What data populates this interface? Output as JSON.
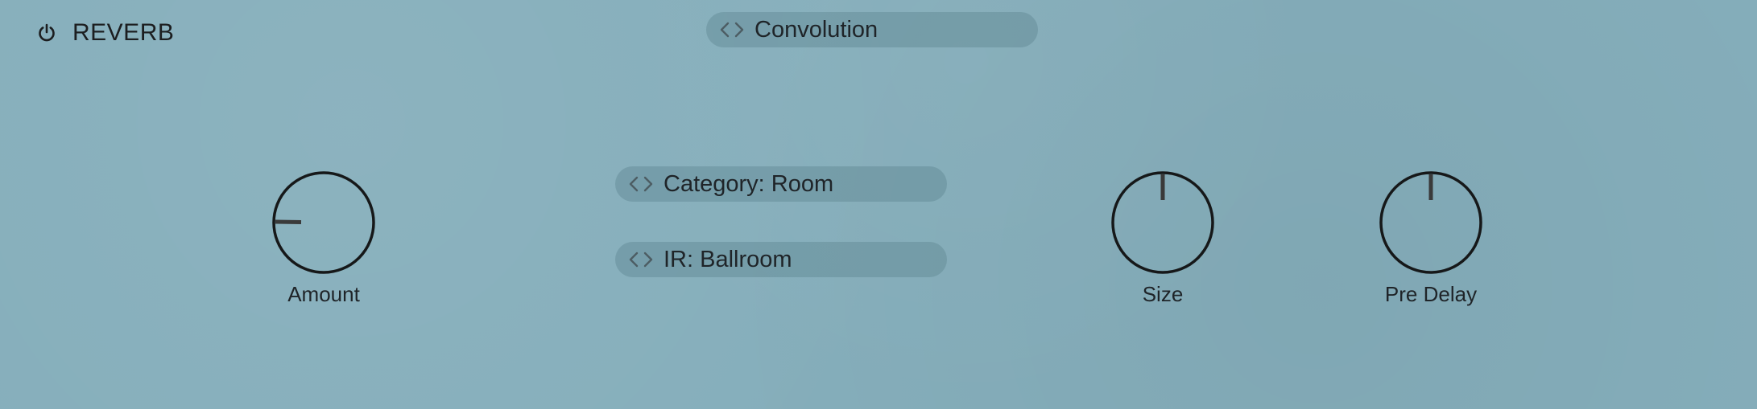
{
  "plugin": {
    "title": "REVERB",
    "power_icon": "power-icon",
    "enabled": true
  },
  "mode_selector": {
    "label": "Convolution",
    "prev_icon": "chevron-left-icon",
    "next_icon": "chevron-right-icon"
  },
  "category_selector": {
    "label": "Category: Room",
    "prev_icon": "chevron-left-icon",
    "next_icon": "chevron-right-icon"
  },
  "ir_selector": {
    "label": "IR: Ballroom",
    "prev_icon": "chevron-left-icon",
    "next_icon": "chevron-right-icon"
  },
  "knobs": [
    {
      "id": "amount",
      "label": "Amount",
      "value_fraction": 0.17
    },
    {
      "id": "size",
      "label": "Size",
      "value_fraction": 0.5
    },
    {
      "id": "pre_delay",
      "label": "Pre Delay",
      "value_fraction": 0.5
    }
  ],
  "colors": {
    "background": "#85aebb",
    "selector_fill": "#6f97a2",
    "knob_ring": "#161819",
    "knob_pointer": "#3a3a3a",
    "text": "#1f2428"
  }
}
